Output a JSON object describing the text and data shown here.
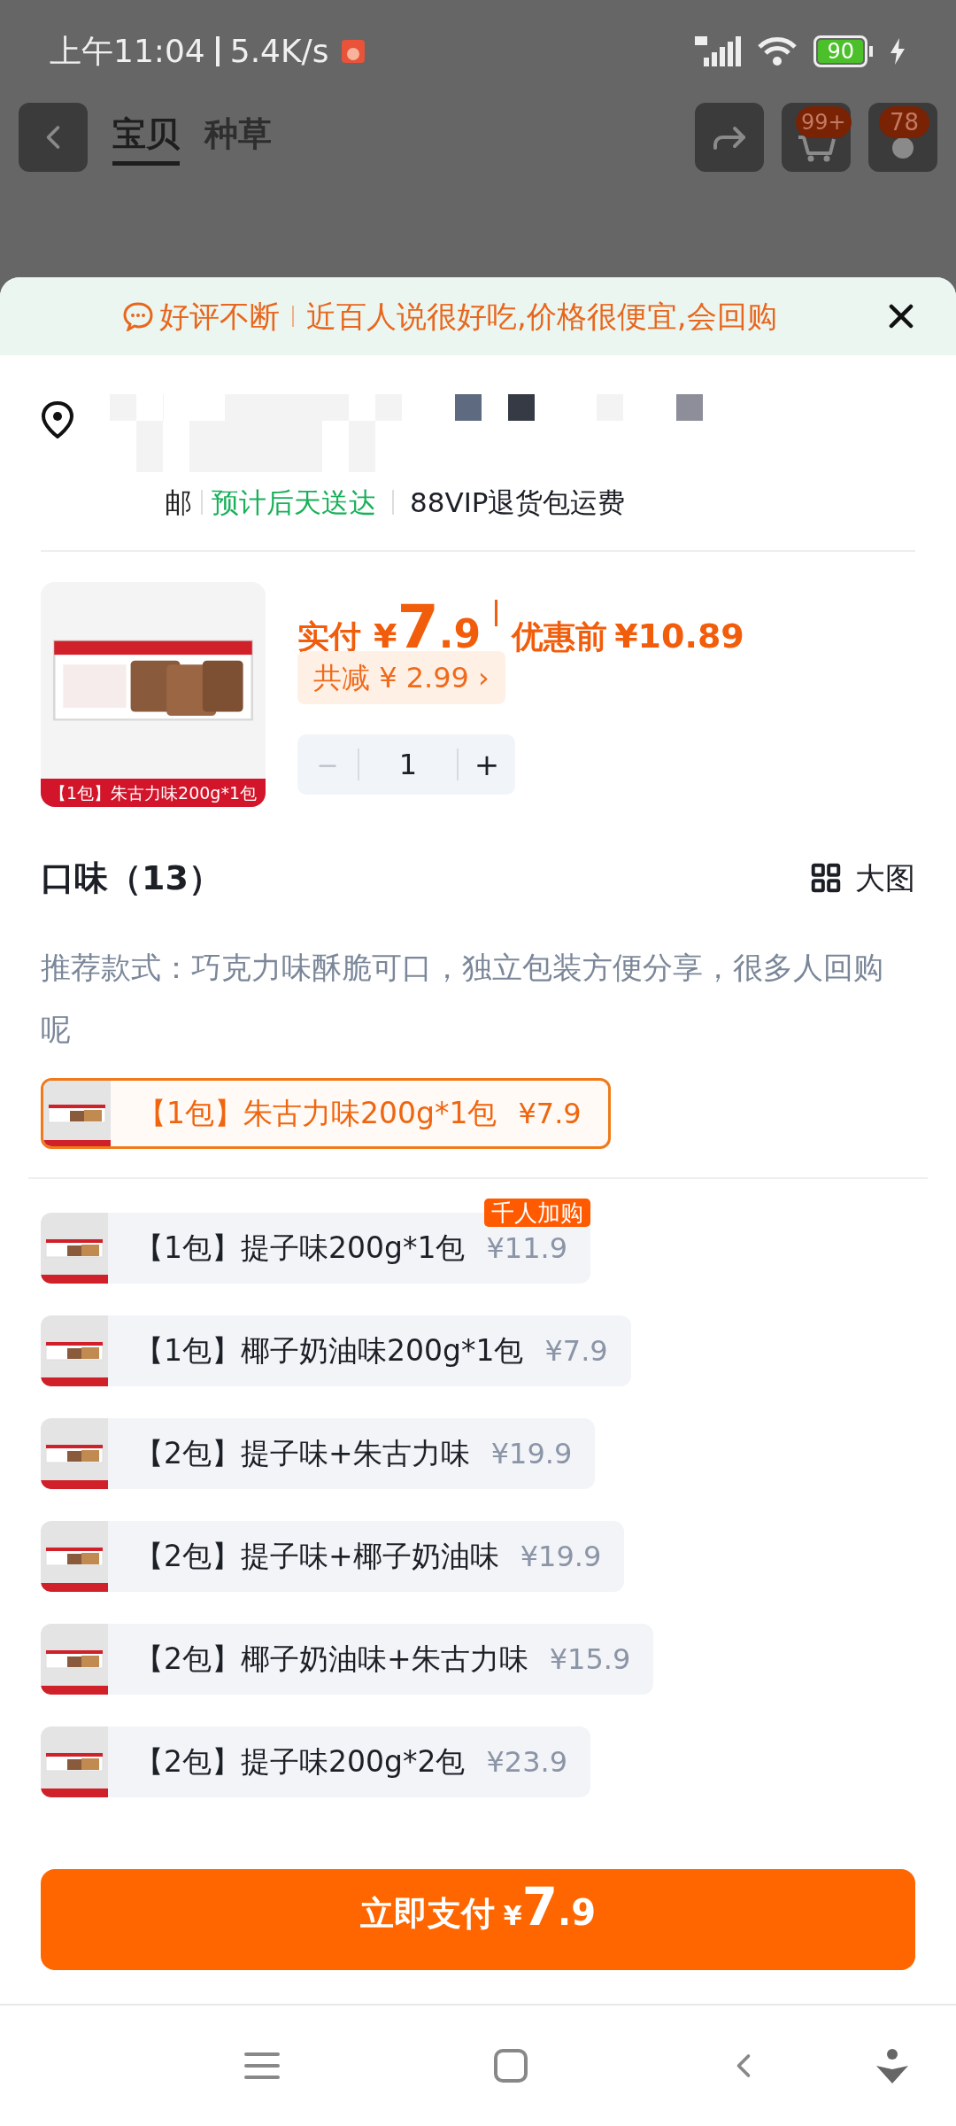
{
  "status_bar": {
    "time": "上午11:04",
    "network_speed": "5.4K/s",
    "battery": "90"
  },
  "header": {
    "tabs": [
      {
        "label": "宝贝",
        "selected": true
      },
      {
        "label": "种草",
        "selected": false
      }
    ],
    "cart_badge": "99+",
    "message_badge": "78"
  },
  "banner": {
    "tag": "好评不断",
    "text": "近百人说很好吃,价格很便宜,会回购"
  },
  "delivery": {
    "shipping": "邮",
    "estimate": "预计后天送达",
    "return_policy": "88VIP退货包运费"
  },
  "product": {
    "image_caption": "【1包】朱古力味200g*1包",
    "pay_label": "实付",
    "currency": "¥",
    "price_integer": "7",
    "price_decimal": ".9",
    "original_label": "优惠前",
    "original_price": "¥10.89",
    "discount": "共减 ¥ 2.99",
    "discount_arrow": "›",
    "minus": "−",
    "quantity": "1",
    "plus": "+"
  },
  "flavor": {
    "title": "口味（13）",
    "view_toggle": "大图",
    "recommendation": "推荐款式：巧克力味酥脆可口，独立包装方便分享，很多人回购呢",
    "options": [
      {
        "label": "【1包】朱古力味200g*1包",
        "price": "¥7.9",
        "selected": true
      },
      {
        "label": "【1包】提子味200g*1包",
        "price": "¥11.9",
        "selected": false,
        "tag": "千人加购"
      },
      {
        "label": "【1包】椰子奶油味200g*1包",
        "price": "¥7.9",
        "selected": false
      },
      {
        "label": "【2包】提子味+朱古力味",
        "price": "¥19.9",
        "selected": false
      },
      {
        "label": "【2包】提子味+椰子奶油味",
        "price": "¥19.9",
        "selected": false
      },
      {
        "label": "【2包】椰子奶油味+朱古力味",
        "price": "¥15.9",
        "selected": false
      },
      {
        "label": "【2包】提子味200g*2包",
        "price": "¥23.9",
        "selected": false
      }
    ]
  },
  "pay_button": {
    "label": "立即支付",
    "currency": "¥",
    "price_integer": "7",
    "price_decimal": ".9"
  }
}
